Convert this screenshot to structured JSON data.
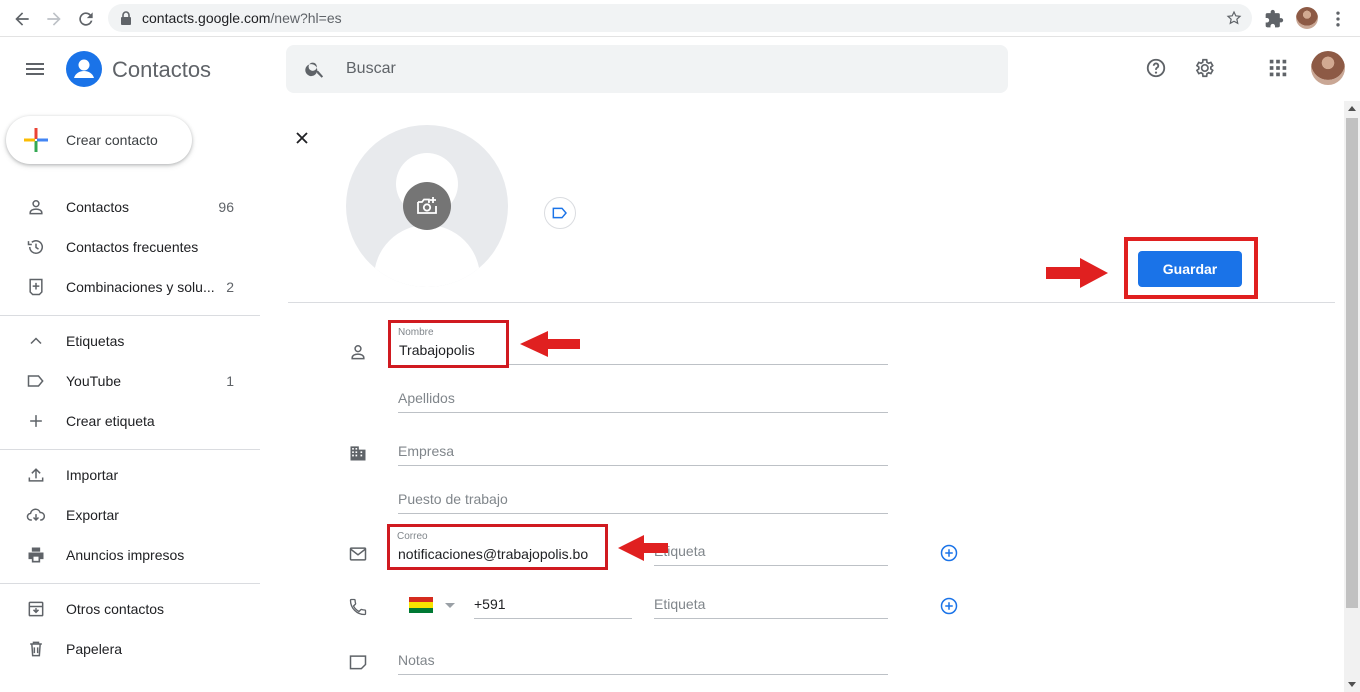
{
  "browser": {
    "url_host": "contacts.google.com",
    "url_path": "/new?hl=es"
  },
  "app": {
    "title": "Contactos",
    "search_placeholder": "Buscar"
  },
  "sidebar": {
    "create_label": "Crear contacto",
    "items": [
      {
        "label": "Contactos",
        "count": "96",
        "icon": "person-icon"
      },
      {
        "label": "Contactos frecuentes",
        "count": "",
        "icon": "history-icon"
      },
      {
        "label": "Combinaciones y solu...",
        "count": "2",
        "icon": "merge-icon"
      },
      {
        "label": "Etiquetas",
        "count": "",
        "icon": "chevron-up-icon"
      },
      {
        "label": "YouTube",
        "count": "1",
        "icon": "label-icon"
      },
      {
        "label": "Crear etiqueta",
        "count": "",
        "icon": "plus-icon"
      },
      {
        "label": "Importar",
        "count": "",
        "icon": "upload-icon"
      },
      {
        "label": "Exportar",
        "count": "",
        "icon": "cloud-download-icon"
      },
      {
        "label": "Anuncios impresos",
        "count": "",
        "icon": "print-icon"
      },
      {
        "label": "Otros contactos",
        "count": "",
        "icon": "archive-icon"
      },
      {
        "label": "Papelera",
        "count": "",
        "icon": "trash-icon"
      }
    ]
  },
  "form": {
    "save_label": "Guardar",
    "name_label": "Nombre",
    "name_value": "Trabajopolis",
    "lastname_placeholder": "Apellidos",
    "company_placeholder": "Empresa",
    "jobtitle_placeholder": "Puesto de trabajo",
    "email_label": "Correo",
    "email_value": "notificaciones@trabajopolis.bo",
    "email_tag_placeholder": "Etiqueta",
    "phone_code": "+591",
    "phone_tag_placeholder": "Etiqueta",
    "notes_placeholder": "Notas",
    "flag_colors": [
      "#d52b1e",
      "#f9e300",
      "#007934"
    ]
  },
  "colors": {
    "accent": "#1a73e8",
    "annotation": "#e02020"
  }
}
